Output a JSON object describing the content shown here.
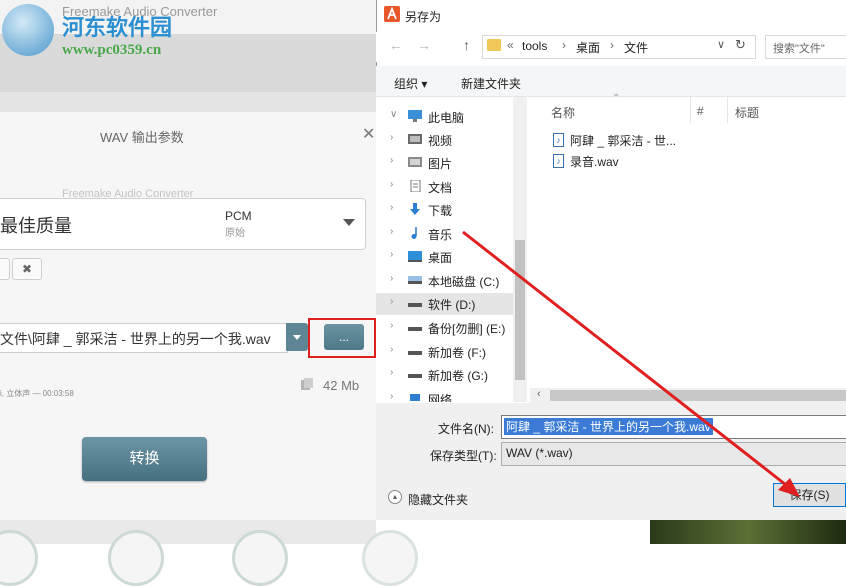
{
  "background_app": {
    "title": "Freemake Audio Converter",
    "watermark_text": "Freemake Audio Converter",
    "dialog_title": "WAV 输出参数",
    "close_glyph": "✕",
    "preset": {
      "name": "最佳质量",
      "codec": "PCM",
      "sub": "原始"
    },
    "small_button_glyph": "✖",
    "output_path": "文件\\阿肆 _ 郭采洁 - 世界上的另一个我.wav",
    "browse_label": "...",
    "info_text": "i, 立体声 — 00:03:58",
    "size_text": "42 Mb",
    "convert_label": "转换"
  },
  "watermark": {
    "title": "河东软件园",
    "url": "www.pc0359.cn"
  },
  "save_dialog": {
    "title": "另存为",
    "nav": {
      "back": "←",
      "forward": "→",
      "up": "↑"
    },
    "breadcrumb": [
      "«",
      "tools",
      "›",
      "桌面",
      "›",
      "文件"
    ],
    "address_dropdown": "∨",
    "refresh": "↻",
    "search_placeholder": "搜索\"文件\"",
    "toolbar": {
      "organize": "组织 ▾",
      "new_folder": "新建文件夹"
    },
    "nav_items": [
      {
        "label": "此电脑",
        "chevron": "∨",
        "icon": "computer-icon"
      },
      {
        "label": "视频",
        "chevron": "›",
        "icon": "video-folder-icon"
      },
      {
        "label": "图片",
        "chevron": "›",
        "icon": "pictures-folder-icon"
      },
      {
        "label": "文档",
        "chevron": "›",
        "icon": "documents-folder-icon"
      },
      {
        "label": "下载",
        "chevron": "›",
        "icon": "download-folder-icon"
      },
      {
        "label": "音乐",
        "chevron": "›",
        "icon": "music-folder-icon"
      },
      {
        "label": "桌面",
        "chevron": "›",
        "icon": "desktop-folder-icon"
      },
      {
        "label": "本地磁盘 (C:)",
        "chevron": "›",
        "icon": "drive-icon"
      },
      {
        "label": "软件 (D:)",
        "chevron": "›",
        "icon": "drive-icon"
      },
      {
        "label": "备份[勿删] (E:)",
        "chevron": "›",
        "icon": "drive-icon"
      },
      {
        "label": "新加卷 (F:)",
        "chevron": "›",
        "icon": "drive-icon"
      },
      {
        "label": "新加卷 (G:)",
        "chevron": "›",
        "icon": "drive-icon"
      },
      {
        "label": "网络",
        "chevron": "›",
        "icon": "network-icon"
      }
    ],
    "selected_nav": "软件 (D:)",
    "columns": [
      "名称",
      "#",
      "标题"
    ],
    "files": [
      {
        "name": "阿肆 _ 郭采洁 - 世...",
        "icon": "audio-file-icon"
      },
      {
        "name": "录音.wav",
        "icon": "audio-file-icon"
      }
    ],
    "scroll_left": "‹",
    "filename_label": "文件名(N):",
    "filename_value": "阿肆 _ 郭采洁 - 世界上的另一个我.wav",
    "filetype_label": "保存类型(T):",
    "filetype_value": "WAV (*.wav)",
    "hide_folders_glyph": "▴",
    "hide_folders_label": "隐藏文件夹",
    "save_label": "保存(S)"
  },
  "colors": {
    "annotation_red": "#e02020",
    "app_button": "#5d8594",
    "selection_blue": "#3b7bd6"
  }
}
